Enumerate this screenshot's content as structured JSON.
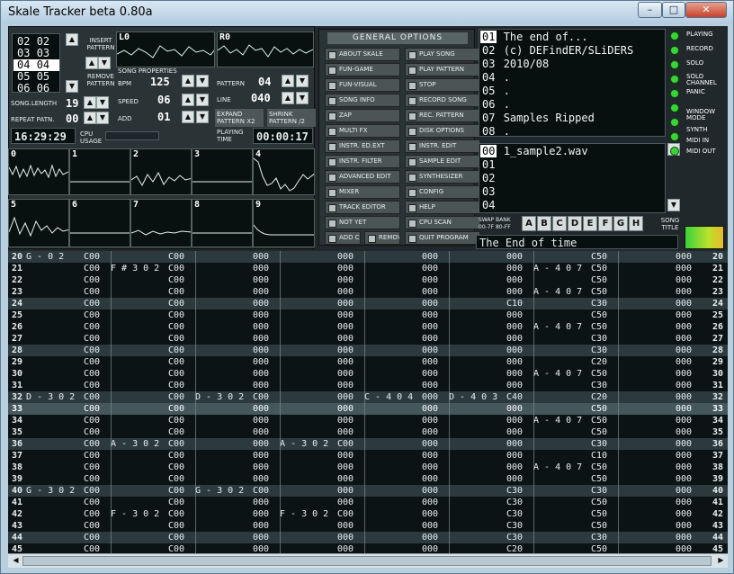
{
  "window": {
    "title": "Skale Tracker beta 0.80a",
    "min": "–",
    "max": "□",
    "close": "✕"
  },
  "order": {
    "rows": [
      [
        "02",
        "02"
      ],
      [
        "03",
        "03"
      ],
      [
        "04",
        "04"
      ],
      [
        "05",
        "05"
      ],
      [
        "06",
        "06"
      ]
    ]
  },
  "left": {
    "insert": "INSERT PATTERN",
    "remove": "REMOVE PATTERN",
    "song_length_label": "SONG.LENGTH",
    "song_length": "19",
    "repeat_label": "REPEAT PATN.",
    "repeat": "00",
    "time": "16:29:29",
    "cpu_label": "CPU USAGE"
  },
  "scopes": {
    "l": "L0",
    "r": "R0",
    "channels": [
      "0",
      "1",
      "2",
      "3",
      "4",
      "5",
      "6",
      "7",
      "8",
      "9"
    ]
  },
  "properties": {
    "heading": "SONG PROPERTIES",
    "bpm_label": "BPM",
    "bpm": "125",
    "speed_label": "SPEED",
    "speed": "06",
    "add_label": "ADD",
    "add": "01",
    "pattern_label": "PATTERN",
    "pattern": "04",
    "line_label": "LINE",
    "line": "040",
    "expand": "EXPAND PATTERN X2",
    "shrink": "SHRINK PATTERN /2",
    "playing_label": "PLAYING TIME",
    "playing_time": "00:00:17"
  },
  "options": {
    "heading": "GENERAL OPTIONS",
    "items": [
      "ABOUT SKALE",
      "PLAY SONG",
      "FUN-GAME",
      "PLAY PATTERN",
      "FUN-VISUAL",
      "STOP",
      "SONG INFO",
      "RECORD SONG",
      "ZAP",
      "REC. PATTERN",
      "MULTI FX",
      "DISK OPTIONS",
      "INSTR. ED.EXT",
      "INSTR. EDIT",
      "INSTR. FILTER",
      "SAMPLE EDIT",
      "ADVANCED EDIT",
      "SYNTHESIZER",
      "MIXER",
      "CONFIG",
      "TRACK EDITOR",
      "HELP",
      "NOT YET",
      "CPU SCAN",
      "ADD CHN.",
      "REMOVE",
      "QUIT PROGRAM"
    ]
  },
  "info": {
    "nums": [
      "01",
      "02",
      "03",
      "04",
      "05",
      "06",
      "07",
      "08"
    ],
    "lines": [
      "The end of...",
      "(c) DEFindER/SLiDERS",
      "2010/08",
      ".",
      ".",
      ".",
      "Samples Ripped",
      "."
    ]
  },
  "samples": {
    "nums": [
      "00",
      "01",
      "02",
      "03",
      "04"
    ],
    "lines": [
      "1_sample2.wav",
      "",
      "",
      "",
      ""
    ],
    "swap": "SWAP BANK 00-7F 80-FF",
    "banks": [
      "A",
      "B",
      "C",
      "D",
      "E",
      "F",
      "G",
      "H"
    ],
    "song_title_label": "SONG TITLE",
    "song_title": "The End of time"
  },
  "right_buttons": [
    "PLAYING",
    "RECORD",
    "SOLO",
    "SOLO CHANNEL",
    "PANIC",
    "WINDOW MODE",
    "SYNTH",
    "MIDI IN",
    "MIDI OUT"
  ],
  "pattern": {
    "channel_nums": [
      "0",
      "1",
      "2",
      "3",
      "4",
      "5",
      "6",
      "7"
    ],
    "rows": [
      [
        "20",
        "G - 0 2",
        "C00",
        "",
        "C00",
        "",
        "000",
        "",
        "000",
        "",
        "000",
        "",
        "000",
        "",
        "C50",
        "",
        "000"
      ],
      [
        "21",
        "",
        "C00",
        "F # 3 0 2",
        "C00",
        "",
        "000",
        "",
        "000",
        "",
        "000",
        "",
        "000",
        "A - 4 0 7",
        "C50",
        "",
        "000"
      ],
      [
        "22",
        "",
        "C00",
        "",
        "C00",
        "",
        "000",
        "",
        "000",
        "",
        "000",
        "",
        "000",
        "",
        "C50",
        "",
        "000"
      ],
      [
        "23",
        "",
        "C00",
        "",
        "C00",
        "",
        "000",
        "",
        "000",
        "",
        "000",
        "",
        "000",
        "A - 4 0 7",
        "C50",
        "",
        "000"
      ],
      [
        "24",
        "",
        "C00",
        "",
        "C00",
        "",
        "000",
        "",
        "000",
        "",
        "000",
        "",
        "C10",
        "",
        "C30",
        "",
        "000"
      ],
      [
        "25",
        "",
        "C00",
        "",
        "C00",
        "",
        "000",
        "",
        "000",
        "",
        "000",
        "",
        "000",
        "",
        "C50",
        "",
        "000"
      ],
      [
        "26",
        "",
        "C00",
        "",
        "C00",
        "",
        "000",
        "",
        "000",
        "",
        "000",
        "",
        "000",
        "A - 4 0 7",
        "C50",
        "",
        "000"
      ],
      [
        "27",
        "",
        "C00",
        "",
        "C00",
        "",
        "000",
        "",
        "000",
        "",
        "000",
        "",
        "000",
        "",
        "C30",
        "",
        "000"
      ],
      [
        "28",
        "",
        "C00",
        "",
        "C00",
        "",
        "000",
        "",
        "000",
        "",
        "000",
        "",
        "000",
        "",
        "C30",
        "",
        "000"
      ],
      [
        "29",
        "",
        "C00",
        "",
        "C00",
        "",
        "000",
        "",
        "000",
        "",
        "000",
        "",
        "000",
        "",
        "C20",
        "",
        "000"
      ],
      [
        "30",
        "",
        "C00",
        "",
        "C00",
        "",
        "000",
        "",
        "000",
        "",
        "000",
        "",
        "000",
        "A - 4 0 7",
        "C50",
        "",
        "000"
      ],
      [
        "31",
        "",
        "C00",
        "",
        "C00",
        "",
        "000",
        "",
        "000",
        "",
        "000",
        "",
        "000",
        "",
        "C30",
        "",
        "000"
      ],
      [
        "32",
        "D - 3 0 2",
        "C00",
        "",
        "C00",
        "D - 3 0 2",
        "C00",
        "",
        "000",
        "C - 4 0 4",
        "000",
        "D - 4 0 3",
        "C40",
        "",
        "C20",
        "",
        "000"
      ],
      [
        "33",
        "",
        "C00",
        "",
        "C00",
        "",
        "000",
        "",
        "000",
        "",
        "000",
        "",
        "000",
        "",
        "C50",
        "",
        "000"
      ],
      [
        "34",
        "",
        "C00",
        "",
        "C00",
        "",
        "000",
        "",
        "000",
        "",
        "000",
        "",
        "000",
        "A - 4 0 7",
        "C50",
        "",
        "000"
      ],
      [
        "35",
        "",
        "C00",
        "",
        "C00",
        "",
        "000",
        "",
        "000",
        "",
        "000",
        "",
        "000",
        "",
        "C50",
        "",
        "000"
      ],
      [
        "36",
        "",
        "C00",
        "A - 3 0 2",
        "C00",
        "",
        "000",
        "A - 3 0 2",
        "C00",
        "",
        "000",
        "",
        "000",
        "",
        "C30",
        "",
        "000"
      ],
      [
        "37",
        "",
        "C00",
        "",
        "C00",
        "",
        "000",
        "",
        "000",
        "",
        "000",
        "",
        "000",
        "",
        "C10",
        "",
        "000"
      ],
      [
        "38",
        "",
        "C00",
        "",
        "C00",
        "",
        "000",
        "",
        "000",
        "",
        "000",
        "",
        "000",
        "A - 4 0 7",
        "C50",
        "",
        "000"
      ],
      [
        "39",
        "",
        "C00",
        "",
        "C00",
        "",
        "000",
        "",
        "000",
        "",
        "000",
        "",
        "000",
        "",
        "C50",
        "",
        "000"
      ],
      [
        "40",
        "G - 3 0 2",
        "C00",
        "",
        "C00",
        "G - 3 0 2",
        "C00",
        "",
        "000",
        "",
        "000",
        "",
        "C30",
        "",
        "C30",
        "",
        "000"
      ],
      [
        "41",
        "",
        "C00",
        "",
        "C00",
        "",
        "000",
        "",
        "000",
        "",
        "000",
        "",
        "C30",
        "",
        "C50",
        "",
        "000"
      ],
      [
        "42",
        "",
        "C00",
        "F - 3 0 2",
        "C00",
        "",
        "000",
        "F - 3 0 2",
        "C00",
        "",
        "000",
        "",
        "C30",
        "",
        "C50",
        "",
        "000"
      ],
      [
        "43",
        "",
        "C00",
        "",
        "C00",
        "",
        "000",
        "",
        "000",
        "",
        "000",
        "",
        "C30",
        "",
        "C50",
        "",
        "000"
      ],
      [
        "44",
        "",
        "C00",
        "",
        "C00",
        "",
        "000",
        "",
        "000",
        "",
        "000",
        "",
        "C30",
        "",
        "C30",
        "",
        "000"
      ],
      [
        "45",
        "",
        "C00",
        "",
        "C00",
        "",
        "000",
        "",
        "000",
        "",
        "000",
        "",
        "C20",
        "",
        "C50",
        "",
        "000"
      ]
    ]
  }
}
